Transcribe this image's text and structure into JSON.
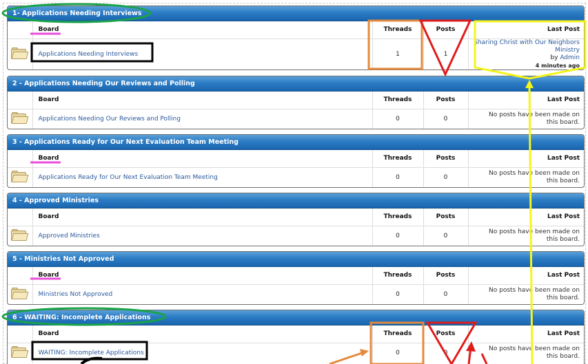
{
  "columns": {
    "board": "Board",
    "threads": "Threads",
    "posts": "Posts",
    "last_post": "Last Post"
  },
  "categories": [
    {
      "title": "1- Applications Needing Interviews",
      "board": "Applications Needing Interviews",
      "threads": "1",
      "posts": "1",
      "last_post": {
        "title": "Sharing Christ with Our Neighbors Ministry",
        "by_label": "by",
        "author": "Admin",
        "time": "4 minutes ago"
      }
    },
    {
      "title": "2 - Applications Needing Our Reviews and Polling",
      "board": "Applications Needing Our Reviews and Polling",
      "threads": "0",
      "posts": "0",
      "no_posts": "No posts have been made on this board."
    },
    {
      "title": "3 - Applications Ready for Our Next Evaluation Team Meeting",
      "board": "Applications Ready for Our Next Evaluation Team Meeting",
      "threads": "0",
      "posts": "0",
      "no_posts": "No posts have been made on this board."
    },
    {
      "title": "4 - Approved Ministries",
      "board": "Approved Ministries",
      "threads": "0",
      "posts": "0",
      "no_posts": "No posts have been made on this board."
    },
    {
      "title": "5 - Ministries Not Approved",
      "board": "Ministries Not Approved",
      "threads": "0",
      "posts": "0",
      "no_posts": "No posts have been made on this board."
    },
    {
      "title": "6 - WAITING: Incomplete Applications",
      "board": "WAITING: Incomplete Applications",
      "threads": "0",
      "posts": "0",
      "no_posts": "No posts have been made on this board."
    }
  ],
  "annotation_colors": {
    "green": "#1aa34a",
    "magenta": "#e84dd8",
    "black": "#000000",
    "orange": "#e58a3c",
    "red": "#e01b1b",
    "yellow": "#f5f51a",
    "header_blue": "#1f6fb8"
  },
  "icons": {
    "board": "folder-icon"
  }
}
